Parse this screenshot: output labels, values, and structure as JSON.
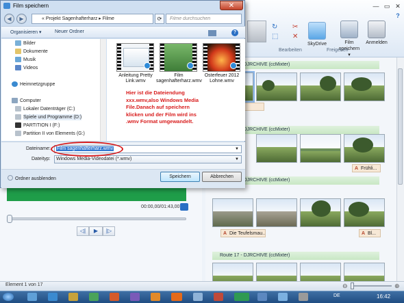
{
  "dialog": {
    "title": "Film speichern",
    "close_label": "✕",
    "path": [
      "Projekt Sagenhafterharz",
      "Filme"
    ],
    "path_text": "« Projekt Sagenhafterharz ▸ Filme",
    "search_placeholder": "Filme durchsuchen",
    "toolbar": {
      "organize": "Organisieren ▾",
      "new_folder": "Neuer Ordner"
    },
    "nav": {
      "bilder": "Bilder",
      "dokumente": "Dokumente",
      "musik": "Musik",
      "videos": "Videos",
      "heimnetz": "Heimnetzgruppe",
      "computer": "Computer",
      "drive_c": "Lokaler Datenträger (C:)",
      "drive_d": "Spiele und Programme (D:)",
      "drive_f": "PARTITION I (F:)",
      "drive_g": "Partition II von Elements (G:)"
    },
    "files": [
      {
        "name": "Anleitung Pretty Link.wmv"
      },
      {
        "name": "Film sagenhafterharz.wmv"
      },
      {
        "name": "Osterfeuer 2012 Lohne.wmv"
      }
    ],
    "annotation": "Hier ist die Dateiendung xxx.wmv,also Windows Media File.Danach auf speichern klicken und der Film wird ins .wmv Format umgewandelt.",
    "filename_label": "Dateiname:",
    "filename_value": "Film sagenhafterharz.wmv",
    "filetype_label": "Dateityp:",
    "filetype_value": "Windows Media-Videodatei (*.wmv)",
    "hide_folders": "Ordner ausblenden",
    "save_label": "Speichern",
    "cancel_label": "Abbrechen"
  },
  "ribbon": {
    "edit_group": "Bearbeiten",
    "share_group": "Freigeben",
    "skydrive": "SkyDrive",
    "save_movie": "Film speichern ▾",
    "sign_in": "Anmelden",
    "help": "?"
  },
  "player": {
    "time": "00:00,00/01:43,00"
  },
  "storyboard": {
    "sections": [
      "Route 16 - DJRCHIVE (ccMixter)",
      "Route 17 - DJRCHIVE (ccMixter)",
      "Route 17 - DJRCHIVE (ccMixter)",
      "Route 17 - DJRCHIVE (ccMixter)"
    ],
    "captions": {
      "c1": "Schritt 20...",
      "c2": "Frühli...",
      "c3": "Die Teufelsmau...",
      "c4": "Bl..."
    }
  },
  "status": {
    "text": "Element 1 von 17"
  },
  "taskbar": {
    "clock": "16:42",
    "lang": "DE"
  },
  "colors": {
    "accent_green": "#1f9d49",
    "annotation_red": "#d81b1b",
    "selection_blue": "#3379d0"
  }
}
